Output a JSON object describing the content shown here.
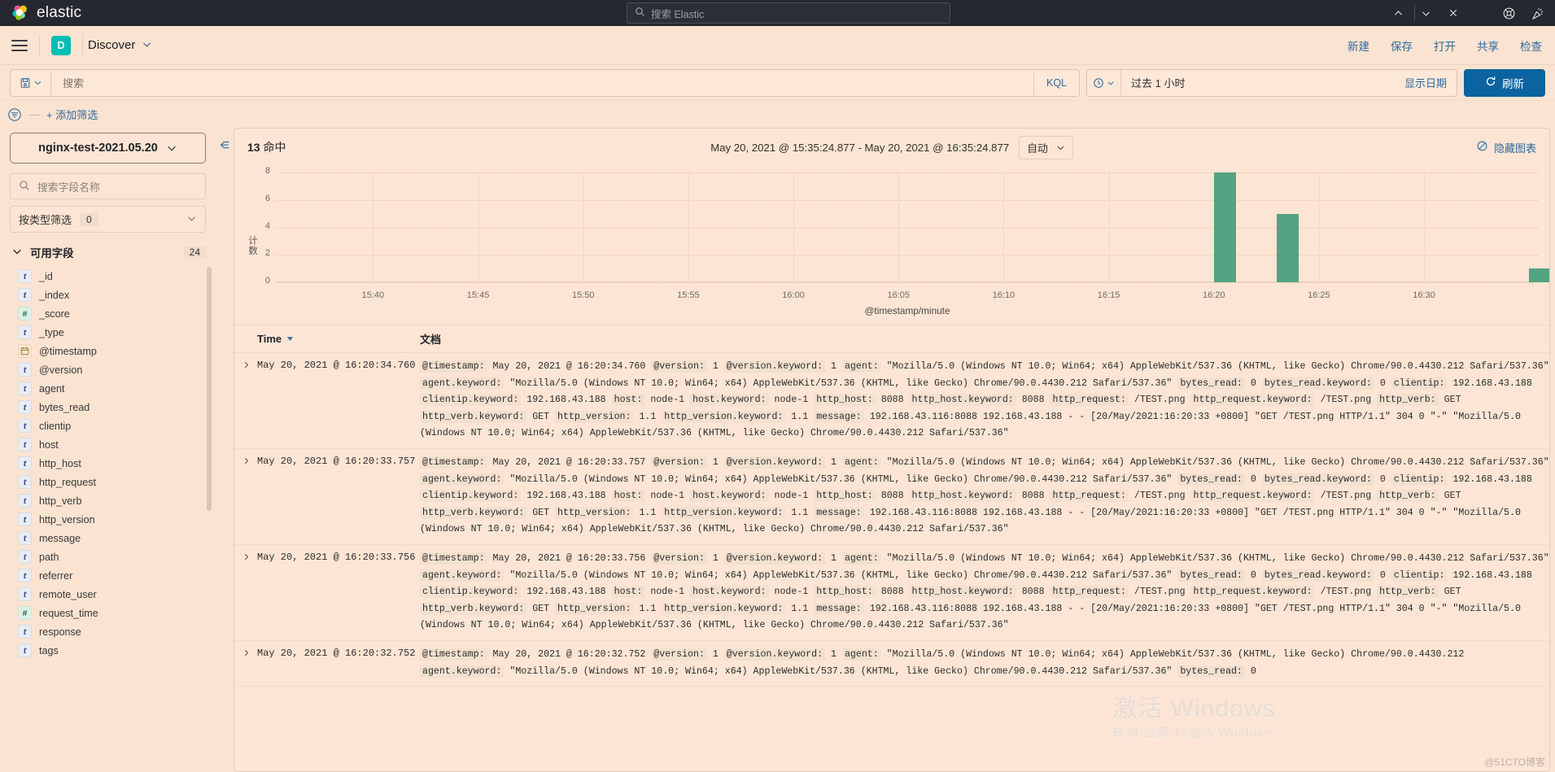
{
  "topbar": {
    "brand": "elastic",
    "search_placeholder": "搜索 Elastic",
    "icons": [
      "chevron-up-icon",
      "chevron-down-icon",
      "close-icon",
      "help-icon",
      "announcement-icon"
    ]
  },
  "header": {
    "app_badge": "D",
    "app_title": "Discover",
    "actions": [
      "新建",
      "保存",
      "打开",
      "共享",
      "检查"
    ]
  },
  "query": {
    "placeholder": "搜索",
    "language": "KQL",
    "date_value": "过去 1 小时",
    "show_dates": "显示日期",
    "refresh": "刷新"
  },
  "filters": {
    "add_label": "+ 添加筛选"
  },
  "sidebar": {
    "index_pattern": "nginx-test-2021.05.20",
    "field_search_placeholder": "搜索字段名称",
    "type_filter_label": "按类型筛选",
    "type_filter_count": "0",
    "available_label": "可用字段",
    "available_count": "24",
    "fields": [
      {
        "name": "_id",
        "type": "t"
      },
      {
        "name": "_index",
        "type": "t"
      },
      {
        "name": "_score",
        "type": "n"
      },
      {
        "name": "_type",
        "type": "t"
      },
      {
        "name": "@timestamp",
        "type": "d"
      },
      {
        "name": "@version",
        "type": "t"
      },
      {
        "name": "agent",
        "type": "t"
      },
      {
        "name": "bytes_read",
        "type": "t"
      },
      {
        "name": "clientip",
        "type": "t"
      },
      {
        "name": "host",
        "type": "t"
      },
      {
        "name": "http_host",
        "type": "t"
      },
      {
        "name": "http_request",
        "type": "t"
      },
      {
        "name": "http_verb",
        "type": "t"
      },
      {
        "name": "http_version",
        "type": "t"
      },
      {
        "name": "message",
        "type": "t"
      },
      {
        "name": "path",
        "type": "t"
      },
      {
        "name": "referrer",
        "type": "t"
      },
      {
        "name": "remote_user",
        "type": "t"
      },
      {
        "name": "request_time",
        "type": "n"
      },
      {
        "name": "response",
        "type": "t"
      },
      {
        "name": "tags",
        "type": "t"
      }
    ]
  },
  "chart_panel": {
    "hits_count": "13",
    "hits_label": "命中",
    "range_text": "May 20, 2021 @ 15:35:24.877 - May 20, 2021 @ 16:35:24.877",
    "interval": "自动",
    "hide_chart": "隐藏图表"
  },
  "chart_data": {
    "type": "bar",
    "title": "",
    "xlabel": "@timestamp/minute",
    "ylabel": "计数",
    "ylim": [
      0,
      8
    ],
    "yticks": [
      0,
      2,
      4,
      6,
      8
    ],
    "xticks": [
      "15:40",
      "15:45",
      "15:50",
      "15:55",
      "16:00",
      "16:05",
      "16:10",
      "16:15",
      "16:20",
      "16:25",
      "16:30"
    ],
    "grid": true,
    "legend": "none",
    "categories": [
      "16:20",
      "16:23",
      "16:35"
    ],
    "values": [
      8,
      5,
      1
    ],
    "bar_color": "#54a382"
  },
  "doc_table": {
    "columns": {
      "time": "Time",
      "doc": "文档"
    },
    "rows": [
      {
        "time": "May 20, 2021 @ 16:20:34.760",
        "doc": [
          {
            "k": "@timestamp:",
            "v": "May 20, 2021 @ 16:20:34.760"
          },
          {
            "k": "@version:",
            "v": "1"
          },
          {
            "k": "@version.keyword:",
            "v": "1"
          },
          {
            "k": "agent:",
            "v": "\"Mozilla/5.0 (Windows NT 10.0; Win64; x64) AppleWebKit/537.36 (KHTML, like Gecko) Chrome/90.0.4430.212 Safari/537.36\""
          },
          {
            "k": "agent.keyword:",
            "v": "\"Mozilla/5.0 (Windows NT 10.0; Win64; x64) AppleWebKit/537.36 (KHTML, like Gecko) Chrome/90.0.4430.212 Safari/537.36\""
          },
          {
            "k": "bytes_read:",
            "v": "0"
          },
          {
            "k": "bytes_read.keyword:",
            "v": "0"
          },
          {
            "k": "clientip:",
            "v": "192.168.43.188"
          },
          {
            "k": "clientip.keyword:",
            "v": "192.168.43.188"
          },
          {
            "k": "host:",
            "v": "node-1"
          },
          {
            "k": "host.keyword:",
            "v": "node-1"
          },
          {
            "k": "http_host:",
            "v": "8088"
          },
          {
            "k": "http_host.keyword:",
            "v": "8088"
          },
          {
            "k": "http_request:",
            "v": "/TEST.png"
          },
          {
            "k": "http_request.keyword:",
            "v": "/TEST.png"
          },
          {
            "k": "http_verb:",
            "v": "GET"
          },
          {
            "k": "http_verb.keyword:",
            "v": "GET"
          },
          {
            "k": "http_version:",
            "v": "1.1"
          },
          {
            "k": "http_version.keyword:",
            "v": "1.1"
          },
          {
            "k": "message:",
            "v": "192.168.43.116:8088 192.168.43.188 - - [20/May/2021:16:20:33 +0800] \"GET /TEST.png HTTP/1.1\" 304 0 \"-\" \"Mozilla/5.0 (Windows NT 10.0; Win64; x64) AppleWebKit/537.36 (KHTML, like Gecko) Chrome/90.0.4430.212 Safari/537.36\""
          }
        ]
      },
      {
        "time": "May 20, 2021 @ 16:20:33.757",
        "doc": [
          {
            "k": "@timestamp:",
            "v": "May 20, 2021 @ 16:20:33.757"
          },
          {
            "k": "@version:",
            "v": "1"
          },
          {
            "k": "@version.keyword:",
            "v": "1"
          },
          {
            "k": "agent:",
            "v": "\"Mozilla/5.0 (Windows NT 10.0; Win64; x64) AppleWebKit/537.36 (KHTML, like Gecko) Chrome/90.0.4430.212 Safari/537.36\""
          },
          {
            "k": "agent.keyword:",
            "v": "\"Mozilla/5.0 (Windows NT 10.0; Win64; x64) AppleWebKit/537.36 (KHTML, like Gecko) Chrome/90.0.4430.212 Safari/537.36\""
          },
          {
            "k": "bytes_read:",
            "v": "0"
          },
          {
            "k": "bytes_read.keyword:",
            "v": "0"
          },
          {
            "k": "clientip:",
            "v": "192.168.43.188"
          },
          {
            "k": "clientip.keyword:",
            "v": "192.168.43.188"
          },
          {
            "k": "host:",
            "v": "node-1"
          },
          {
            "k": "host.keyword:",
            "v": "node-1"
          },
          {
            "k": "http_host:",
            "v": "8088"
          },
          {
            "k": "http_host.keyword:",
            "v": "8088"
          },
          {
            "k": "http_request:",
            "v": "/TEST.png"
          },
          {
            "k": "http_request.keyword:",
            "v": "/TEST.png"
          },
          {
            "k": "http_verb:",
            "v": "GET"
          },
          {
            "k": "http_verb.keyword:",
            "v": "GET"
          },
          {
            "k": "http_version:",
            "v": "1.1"
          },
          {
            "k": "http_version.keyword:",
            "v": "1.1"
          },
          {
            "k": "message:",
            "v": "192.168.43.116:8088 192.168.43.188 - - [20/May/2021:16:20:33 +0800] \"GET /TEST.png HTTP/1.1\" 304 0 \"-\" \"Mozilla/5.0 (Windows NT 10.0; Win64; x64) AppleWebKit/537.36 (KHTML, like Gecko) Chrome/90.0.4430.212 Safari/537.36\""
          }
        ]
      },
      {
        "time": "May 20, 2021 @ 16:20:33.756",
        "doc": [
          {
            "k": "@timestamp:",
            "v": "May 20, 2021 @ 16:20:33.756"
          },
          {
            "k": "@version:",
            "v": "1"
          },
          {
            "k": "@version.keyword:",
            "v": "1"
          },
          {
            "k": "agent:",
            "v": "\"Mozilla/5.0 (Windows NT 10.0; Win64; x64) AppleWebKit/537.36 (KHTML, like Gecko) Chrome/90.0.4430.212 Safari/537.36\""
          },
          {
            "k": "agent.keyword:",
            "v": "\"Mozilla/5.0 (Windows NT 10.0; Win64; x64) AppleWebKit/537.36 (KHTML, like Gecko) Chrome/90.0.4430.212 Safari/537.36\""
          },
          {
            "k": "bytes_read:",
            "v": "0"
          },
          {
            "k": "bytes_read.keyword:",
            "v": "0"
          },
          {
            "k": "clientip:",
            "v": "192.168.43.188"
          },
          {
            "k": "clientip.keyword:",
            "v": "192.168.43.188"
          },
          {
            "k": "host:",
            "v": "node-1"
          },
          {
            "k": "host.keyword:",
            "v": "node-1"
          },
          {
            "k": "http_host:",
            "v": "8088"
          },
          {
            "k": "http_host.keyword:",
            "v": "8088"
          },
          {
            "k": "http_request:",
            "v": "/TEST.png"
          },
          {
            "k": "http_request.keyword:",
            "v": "/TEST.png"
          },
          {
            "k": "http_verb:",
            "v": "GET"
          },
          {
            "k": "http_verb.keyword:",
            "v": "GET"
          },
          {
            "k": "http_version:",
            "v": "1.1"
          },
          {
            "k": "http_version.keyword:",
            "v": "1.1"
          },
          {
            "k": "message:",
            "v": "192.168.43.116:8088 192.168.43.188 - - [20/May/2021:16:20:33 +0800] \"GET /TEST.png HTTP/1.1\" 304 0 \"-\" \"Mozilla/5.0 (Windows NT 10.0; Win64; x64) AppleWebKit/537.36 (KHTML, like Gecko) Chrome/90.0.4430.212 Safari/537.36\""
          }
        ]
      },
      {
        "time": "May 20, 2021 @ 16:20:32.752",
        "doc": [
          {
            "k": "@timestamp:",
            "v": "May 20, 2021 @ 16:20:32.752"
          },
          {
            "k": "@version:",
            "v": "1"
          },
          {
            "k": "@version.keyword:",
            "v": "1"
          },
          {
            "k": "agent:",
            "v": "\"Mozilla/5.0 (Windows NT 10.0; Win64; x64) AppleWebKit/537.36 (KHTML, like Gecko) Chrome/90.0.4430.212"
          },
          {
            "k": "agent.keyword:",
            "v": "\"Mozilla/5.0 (Windows NT 10.0; Win64; x64) AppleWebKit/537.36 (KHTML, like Gecko) Chrome/90.0.4430.212 Safari/537.36\""
          },
          {
            "k": "bytes_read:",
            "v": "0"
          }
        ]
      }
    ]
  },
  "watermark": {
    "line1": "激活 Windows",
    "line2": "转到\"设置\"以激活 Windows。",
    "credit": "@51CTO博客"
  },
  "colors": {
    "brand_dark": "#25282f",
    "accent_teal": "#00bfb3",
    "link_blue": "#2f6a9e",
    "button_blue": "#0b64a0",
    "bar_green": "#54a382",
    "page_bg": "#fbe3d1"
  }
}
